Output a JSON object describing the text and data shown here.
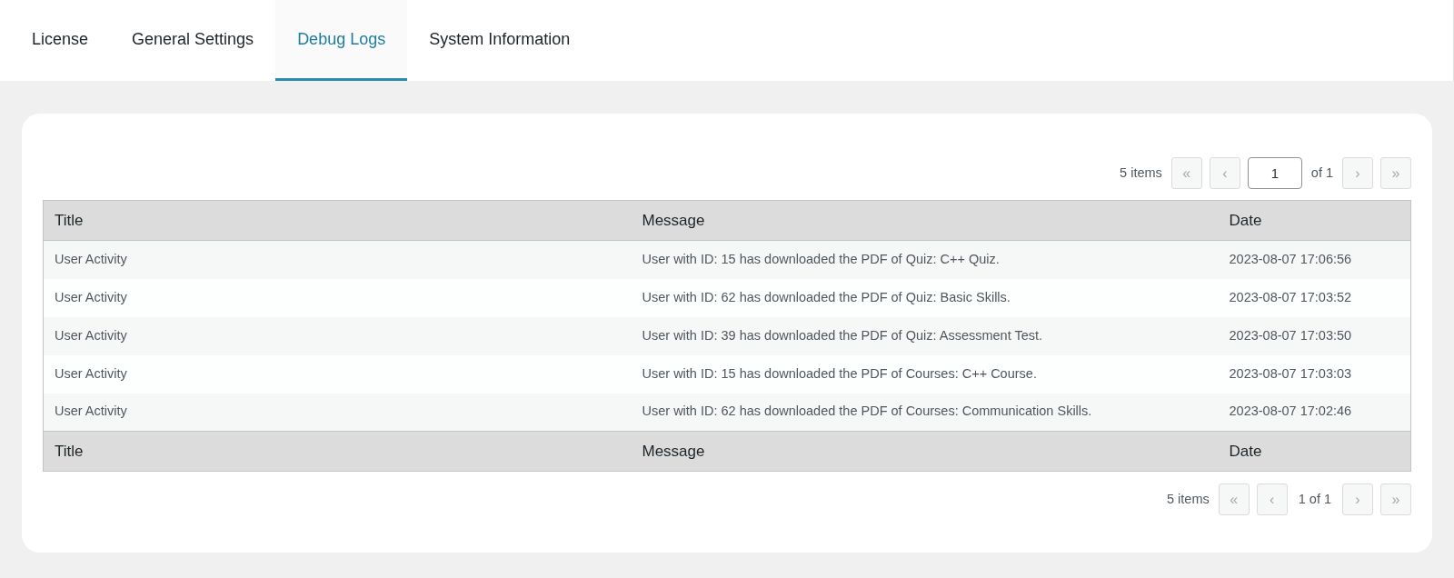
{
  "tabs": [
    {
      "label": "License",
      "selected": false
    },
    {
      "label": "General Settings",
      "selected": false
    },
    {
      "label": "Debug Logs",
      "selected": true
    },
    {
      "label": "System Information",
      "selected": false
    }
  ],
  "pagination_top": {
    "count": "5 items",
    "first": {
      "label": "«",
      "disabled": true
    },
    "prev": {
      "label": "‹",
      "disabled": true
    },
    "page_input": {
      "value": "1"
    },
    "of": "of 1",
    "next": {
      "label": "›",
      "disabled": true
    },
    "last": {
      "label": "»",
      "disabled": true
    }
  },
  "table": {
    "columns": [
      "Title",
      "Message",
      "Date"
    ],
    "rows": [
      {
        "title": "User Activity",
        "message": "User with ID: 15 has downloaded the PDF of Quiz: C++ Quiz.",
        "date": "2023-08-07 17:06:56"
      },
      {
        "title": "User Activity",
        "message": "User with ID: 62 has downloaded the PDF of Quiz: Basic Skills.",
        "date": "2023-08-07 17:03:52"
      },
      {
        "title": "User Activity",
        "message": "User with ID: 39 has downloaded the PDF of Quiz: Assessment Test.",
        "date": "2023-08-07 17:03:50"
      },
      {
        "title": "User Activity",
        "message": "User with ID: 15 has downloaded the PDF of Courses: C++ Course.",
        "date": "2023-08-07 17:03:03"
      },
      {
        "title": "User Activity",
        "message": "User with ID: 62 has downloaded the PDF of Courses: Communication Skills.",
        "date": "2023-08-07 17:02:46"
      }
    ],
    "footer_columns": [
      "Title",
      "Message",
      "Date"
    ]
  },
  "pagination_bottom": {
    "count": "5 items",
    "first": {
      "label": "«",
      "disabled": true
    },
    "prev": {
      "label": "‹",
      "disabled": true
    },
    "page_info": "1 of 1",
    "next": {
      "label": "›",
      "disabled": true
    },
    "last": {
      "label": "»",
      "disabled": true
    }
  }
}
